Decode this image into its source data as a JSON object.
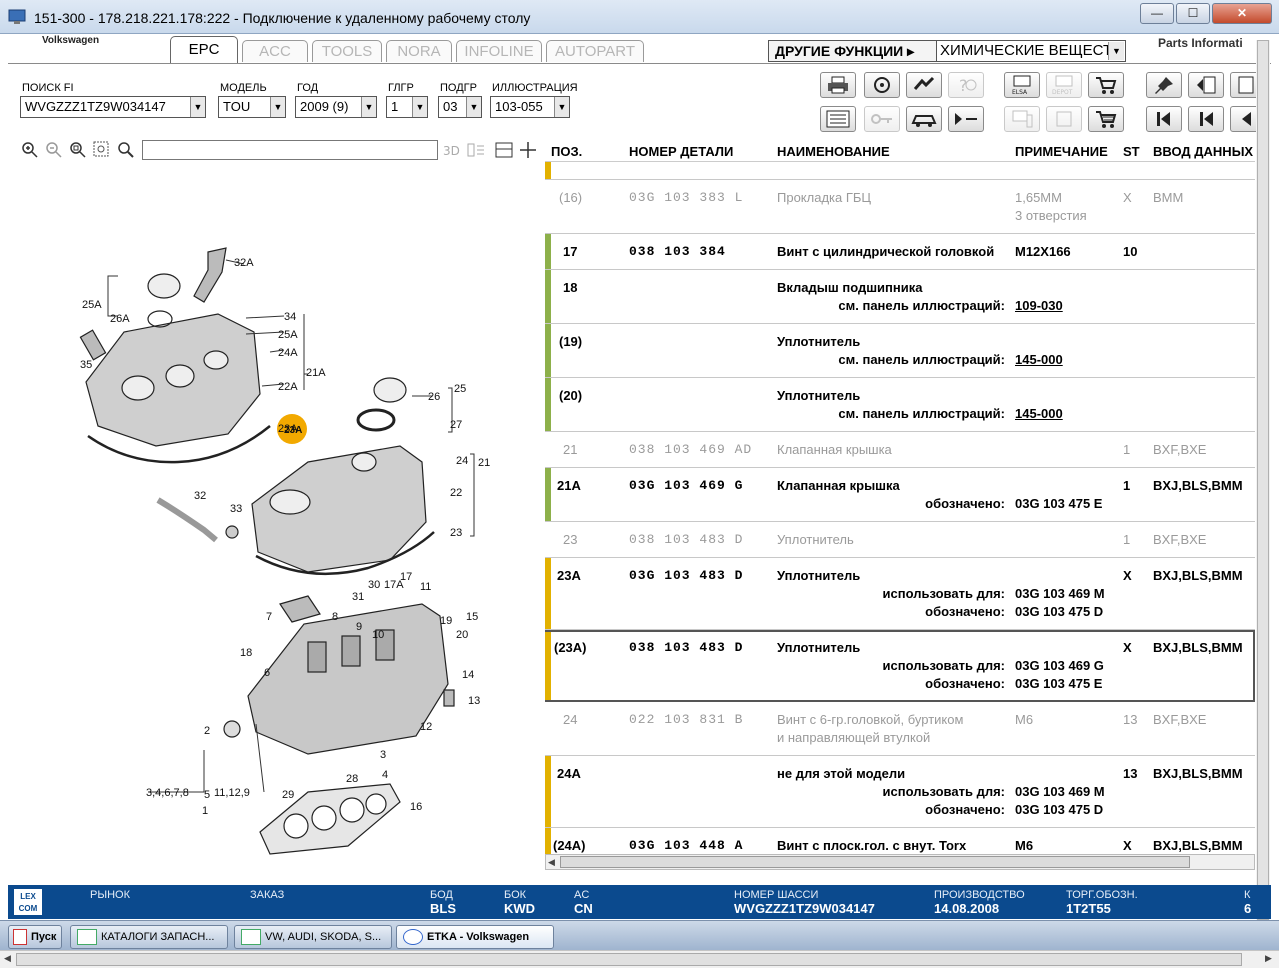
{
  "window": {
    "title": "151-300 - 178.218.221.178:222 - Подключение к удаленному рабочему столу",
    "min_label": "—",
    "max_label": "☐",
    "close_label": "✕"
  },
  "app": {
    "brand": "Volkswagen",
    "parts_info": "Parts Informati",
    "tabs": [
      {
        "label": "EPC"
      },
      {
        "label": "ACC"
      },
      {
        "label": "TOOLS"
      },
      {
        "label": "NORA"
      },
      {
        "label": "INFOLINE"
      },
      {
        "label": "AUTOPART"
      }
    ],
    "other_functions": "ДРУГИЕ ФУНКЦИИ ▸",
    "chem_value": "ХИМИЧЕСКИЕ ВЕЩЕСТ"
  },
  "fields": {
    "search": {
      "label": "ПОИСК FI",
      "value": "WVGZZZ1TZ9W034147"
    },
    "model": {
      "label": "МОДЕЛЬ",
      "value": "TOU"
    },
    "year": {
      "label": "ГОД",
      "value": "2009 (9)"
    },
    "mgroup": {
      "label": "ГЛГР",
      "value": "1"
    },
    "sgroup": {
      "label": "ПОДГР",
      "value": "03"
    },
    "illustration": {
      "label": "ИЛЛЮСТРАЦИЯ",
      "value": "103-055"
    }
  },
  "illustration": {
    "labels": [
      "32A",
      "25A",
      "26A",
      "35",
      "34",
      "25A",
      "24A",
      "21A",
      "22A",
      "23A",
      "26",
      "25",
      "27",
      "24",
      "21",
      "22",
      "23",
      "32",
      "33",
      "30",
      "17A",
      "17",
      "11",
      "31",
      "7",
      "8",
      "9",
      "10",
      "19",
      "20",
      "15",
      "18",
      "6",
      "14",
      "13",
      "2",
      "12",
      "3",
      "4",
      "5",
      "28",
      "29",
      "16",
      "1",
      "3,4,6,7,8",
      "11,12,9"
    ],
    "highlight": "23A"
  },
  "table": {
    "headers": {
      "pos": "ПОЗ.",
      "part": "НОМЕР ДЕТАЛИ",
      "name": "НАИМЕНОВАНИЕ",
      "note": "ПРИМЕЧАНИЕ",
      "st": "ST",
      "data": "ВВОД ДАННЫХ"
    },
    "rows": [
      {
        "pos": "(16)",
        "part": "03G 103 383 L",
        "name": "Прокладка ГБЦ",
        "note": "1,65MM",
        "note2": "3 отверстия",
        "st": "X",
        "data": "BMM"
      },
      {
        "pos": "17",
        "part": "038 103 384",
        "name": "Винт с цилиндрической головкой",
        "note": "M12X166",
        "st": "10",
        "data": ""
      },
      {
        "pos": "18",
        "name": "Вкладыш подшипника",
        "sub_label": "см. панель иллюстраций:",
        "sub_value": "109-030"
      },
      {
        "pos": "(19)",
        "name": "Уплотнитель",
        "sub_label": "см. панель иллюстраций:",
        "sub_value": "145-000"
      },
      {
        "pos": "(20)",
        "name": "Уплотнитель",
        "sub_label": "см. панель иллюстраций:",
        "sub_value": "145-000"
      },
      {
        "pos": "21",
        "part": "038 103 469 AD",
        "name": "Клапанная крышка",
        "st": "1",
        "data": "BXF,BXE"
      },
      {
        "pos": "21A",
        "part": "03G 103 469 G",
        "name": "Клапанная крышка",
        "st": "1",
        "data": "BXJ,BLS,BMM",
        "sub_label": "обозначено:",
        "sub_value": "03G 103 475 E"
      },
      {
        "pos": "23",
        "part": "038 103 483 D",
        "name": "Уплотнитель",
        "st": "1",
        "data": "BXF,BXE"
      },
      {
        "pos": "23A",
        "part": "03G 103 483 D",
        "name": "Уплотнитель",
        "st": "X",
        "data": "BXJ,BLS,BMM",
        "sub_label": "использовать для:",
        "sub_value": "03G 103 469 M",
        "sub_label2": "обозначено:",
        "sub_value2": "03G 103 475 D"
      },
      {
        "pos": "(23A)",
        "part": "038 103 483 D",
        "name": "Уплотнитель",
        "st": "X",
        "data": "BXJ,BLS,BMM",
        "sub_label": "использовать для:",
        "sub_value": "03G 103 469 G",
        "sub_label2": "обозначено:",
        "sub_value2": "03G 103 475 E"
      },
      {
        "pos": "24",
        "part": "022 103 831 B",
        "name": "Винт с 6-гр.головкой, буртиком",
        "name2": "и направляющей втулкой",
        "note": "M6",
        "st": "13",
        "data": "BXF,BXE"
      },
      {
        "pos": "24A",
        "name": "не для этой модели",
        "st": "13",
        "data": "BXJ,BLS,BMM",
        "sub_label": "использовать для:",
        "sub_value": "03G 103 469 M",
        "sub_label2": "обозначено:",
        "sub_value2": "03G 103 475 D"
      },
      {
        "pos": "(24A)",
        "part": "03G 103 448 A",
        "name": "Винт с плоск.гол. с внут. Torx",
        "note": "M6",
        "st": "X",
        "data": "BXJ,BLS,BMM"
      }
    ]
  },
  "status": {
    "logo": "LEX COM",
    "market": {
      "label": "РЫНОК",
      "value": ""
    },
    "order": {
      "label": "ЗАКАЗ",
      "value": ""
    },
    "bod": {
      "label": "БОД",
      "value": "BLS"
    },
    "bok": {
      "label": "БОК",
      "value": "KWD"
    },
    "ac": {
      "label": "AC",
      "value": "CN"
    },
    "chassis": {
      "label": "НОМЕР ШАССИ",
      "value": "WVGZZZ1TZ9W034147"
    },
    "production": {
      "label": "ПРОИЗВОДСТВО",
      "value": "14.08.2008"
    },
    "trade": {
      "label": "ТОРГ.ОБОЗН.",
      "value": "1T2T55"
    },
    "extra": {
      "label": "К",
      "value": "6"
    }
  },
  "taskbar": {
    "start": "Пуск",
    "items": [
      "КАТАЛОГИ ЗАПАСН...",
      "VW, AUDI, SKODA, S...",
      "ETKA - Volkswagen"
    ]
  },
  "colors": {
    "green": "#8db04a",
    "yellow": "#e2b100",
    "status_bg": "#0b4a8e"
  }
}
